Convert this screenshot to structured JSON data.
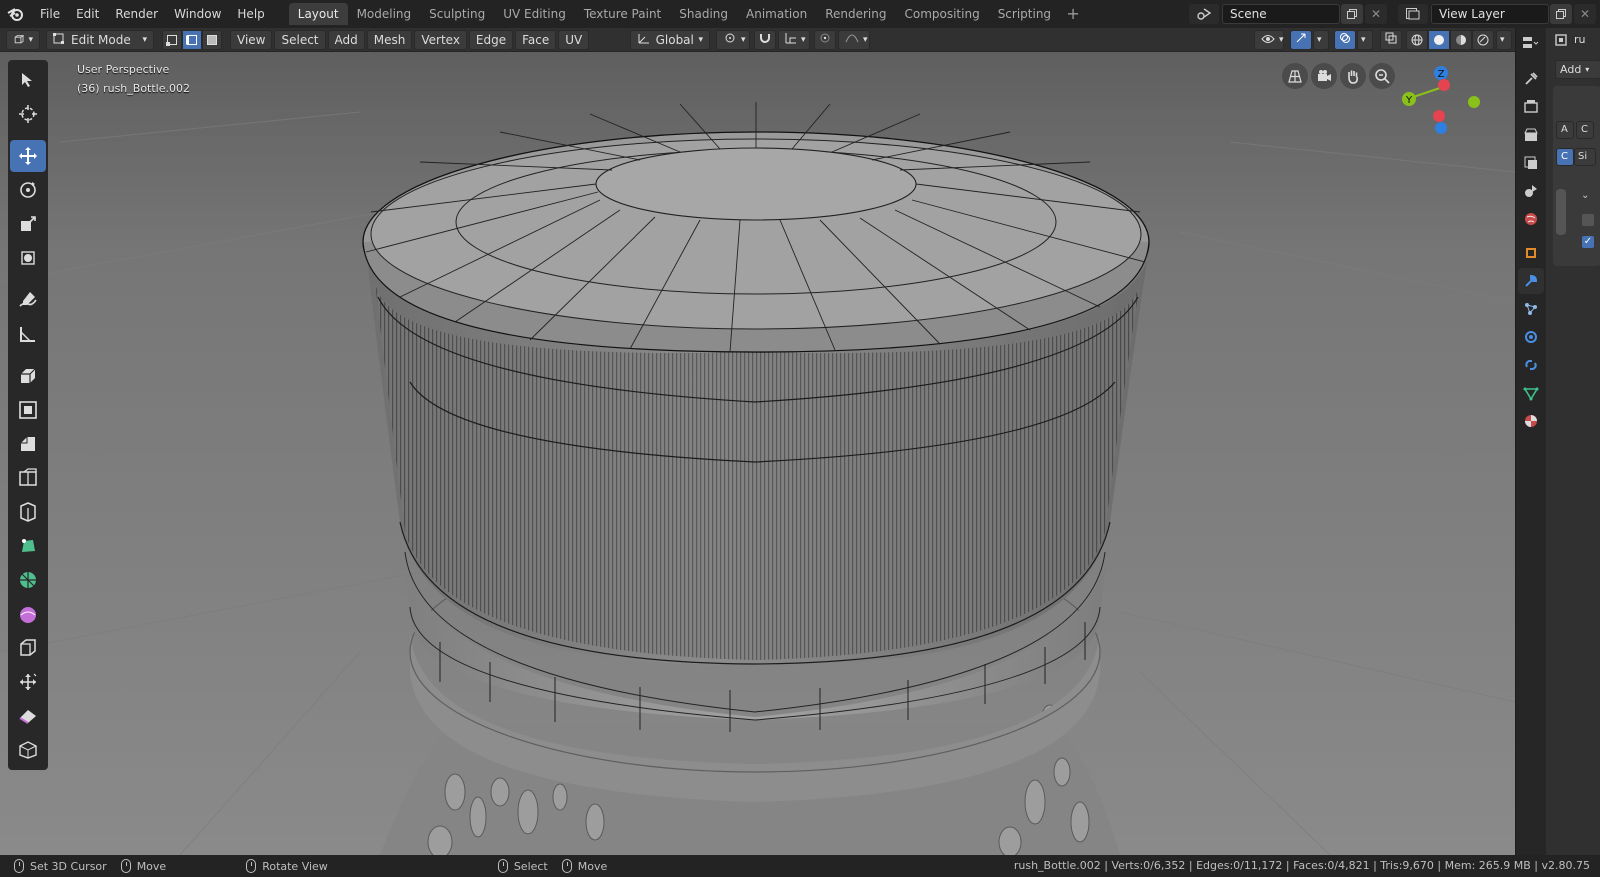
{
  "menu": [
    "File",
    "Edit",
    "Render",
    "Window",
    "Help"
  ],
  "workspace_tabs": [
    {
      "label": "Layout",
      "active": true
    },
    {
      "label": "Modeling"
    },
    {
      "label": "Sculpting"
    },
    {
      "label": "UV Editing"
    },
    {
      "label": "Texture Paint"
    },
    {
      "label": "Shading"
    },
    {
      "label": "Animation"
    },
    {
      "label": "Rendering"
    },
    {
      "label": "Compositing"
    },
    {
      "label": "Scripting"
    }
  ],
  "scene": {
    "name": "Scene",
    "view_layer": "View Layer"
  },
  "header": {
    "mode": "Edit Mode",
    "menus": [
      "View",
      "Select",
      "Add",
      "Mesh",
      "Vertex",
      "Edge",
      "Face",
      "UV"
    ],
    "transform_orientation": "Global",
    "select_mode": "edge"
  },
  "viewport": {
    "perspective": "User Perspective",
    "object_label": "(36) rush_Bottle.002",
    "gizmo_axes": {
      "z": "Z",
      "y": "Y"
    }
  },
  "tools": [
    {
      "name": "select-box-icon"
    },
    {
      "name": "cursor-icon"
    },
    {
      "name": "move-icon",
      "active": true
    },
    {
      "name": "rotate-icon"
    },
    {
      "name": "scale-icon"
    },
    {
      "name": "transform-icon"
    },
    {
      "name": "annotate-icon"
    },
    {
      "name": "measure-icon"
    },
    {
      "name": "extrude-icon"
    },
    {
      "name": "inset-icon"
    },
    {
      "name": "bevel-icon"
    },
    {
      "name": "loop-cut-icon"
    },
    {
      "name": "knife-icon"
    },
    {
      "name": "poly-build-icon"
    },
    {
      "name": "spin-icon"
    },
    {
      "name": "smooth-icon"
    },
    {
      "name": "edge-slide-icon"
    },
    {
      "name": "shrink-fatten-icon"
    },
    {
      "name": "shear-icon"
    },
    {
      "name": "rip-region-icon"
    }
  ],
  "properties": {
    "add_label": "Add",
    "buttons": [
      "A",
      "C",
      "C",
      "Si"
    ]
  },
  "statusbar": {
    "left": [
      {
        "label": "Set 3D Cursor"
      },
      {
        "label": "Move"
      },
      {
        "label": "Rotate View"
      },
      {
        "label": "Select"
      },
      {
        "label": "Move"
      }
    ],
    "stats": "rush_Bottle.002 | Verts:0/6,352 | Edges:0/11,172 | Faces:0/4,821 | Tris:9,670 | Mem: 265.9 MB | v2.80.75"
  },
  "colors": {
    "accent": "#4772b3",
    "axis_x": "#e4434f",
    "axis_y": "#8ac01a",
    "axis_z": "#2f7fe0"
  }
}
